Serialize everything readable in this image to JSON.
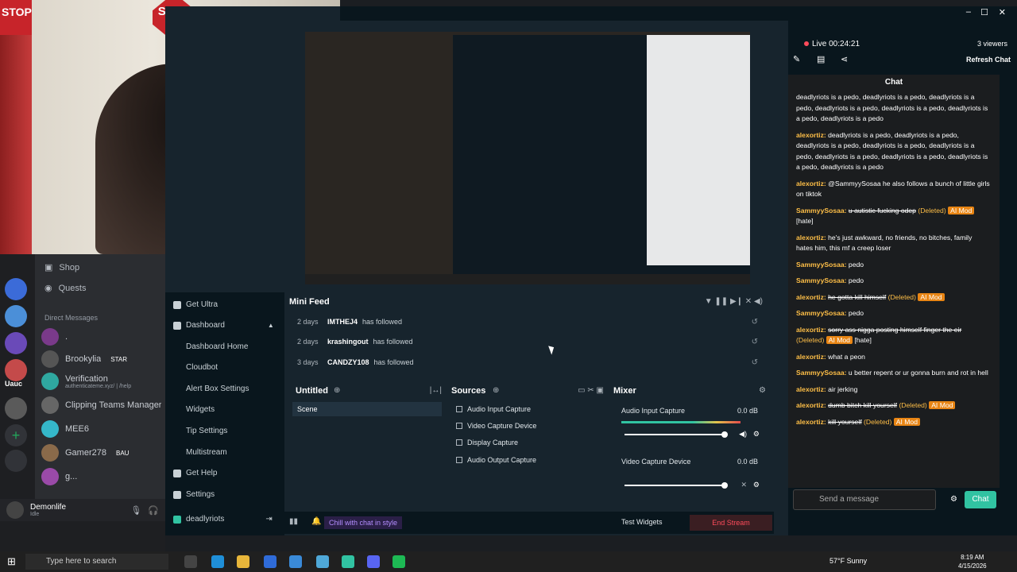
{
  "webcam": {
    "stop_left": "STOP",
    "stop_right": "STOP"
  },
  "discord": {
    "nav": [
      {
        "label": "Shop"
      },
      {
        "label": "Quests"
      }
    ],
    "dm_header": "Direct Messages",
    "dms": [
      {
        "name": ".",
        "tag": "",
        "sub": ""
      },
      {
        "name": "Brookylia",
        "tag": "STAR",
        "sub": ""
      },
      {
        "name": "Verification",
        "tag": "",
        "sub": "authenticateme.xyz/ | /help"
      },
      {
        "name": "Clipping Teams Manager",
        "tag": "",
        "sub": ""
      },
      {
        "name": "MEE6",
        "tag": "",
        "sub": ""
      },
      {
        "name": "Gamer278",
        "tag": "BAU",
        "sub": ""
      },
      {
        "name": "g...",
        "tag": "",
        "sub": ""
      }
    ],
    "guild_label": "Uauc",
    "user": {
      "name": "Demonlife",
      "status": "Idle"
    }
  },
  "streamlabs": {
    "nav": {
      "get_ultra": "Get Ultra",
      "dashboard": "Dashboard",
      "dashboard_home": "Dashboard Home",
      "cloudbot": "Cloudbot",
      "alert_box": "Alert Box Settings",
      "widgets": "Widgets",
      "tip_settings": "Tip Settings",
      "multistream": "Multistream",
      "get_help": "Get Help",
      "settings": "Settings",
      "account": "deadlyriots"
    },
    "mini_feed": {
      "title": "Mini Feed",
      "rows": [
        {
          "time": "2 days",
          "user": "IMTHEJ4",
          "action": "has followed"
        },
        {
          "time": "2 days",
          "user": "krashingout",
          "action": "has followed"
        },
        {
          "time": "3 days",
          "user": "CANDZY108",
          "action": "has followed"
        }
      ]
    },
    "scenes": {
      "title": "Untitled",
      "items": [
        "Scene"
      ]
    },
    "sources": {
      "title": "Sources",
      "items": [
        "Audio Input Capture",
        "Video Capture Device",
        "Display Capture",
        "Audio Output Capture"
      ]
    },
    "mixer": {
      "title": "Mixer",
      "channels": [
        {
          "name": "Audio Input Capture",
          "db": "0.0 dB"
        },
        {
          "name": "Video Capture Device",
          "db": "0.0 dB"
        }
      ]
    },
    "footer": {
      "chill": "Chill with chat in style",
      "test_widgets": "Test Widgets",
      "end_stream": "End Stream"
    }
  },
  "chat": {
    "live": "Live 00:24:21",
    "viewers": "3 viewers",
    "refresh": "Refresh Chat",
    "title": "Chat",
    "messages": [
      {
        "user": "",
        "text": "deadlyriots is a pedo, deadlyriots is a pedo, deadlyriots is a pedo, deadlyriots is a pedo, deadlyriots is a pedo, deadlyriots is a pedo, deadlyriots is a pedo",
        "deleted": false
      },
      {
        "user": "alexortiz:",
        "text": "deadlyriots is a pedo, deadlyriots is a pedo, deadlyriots is a pedo, deadlyriots is a pedo, deadlyriots is a pedo, deadlyriots is a pedo, deadlyriots is a pedo, deadlyriots is a pedo, deadlyriots is a pedo",
        "deleted": false
      },
      {
        "user": "alexortiz:",
        "text": "@SammyySosaa he also follows a bunch of little girls on tiktok",
        "deleted": false
      },
      {
        "user": "SammyySosaa:",
        "text": "u autistic fucking odep",
        "deleted": true,
        "extra": "[hate]"
      },
      {
        "user": "alexortiz:",
        "text": "he's just awkward, no friends, no bitches, family hates him, this mf a creep loser",
        "deleted": false
      },
      {
        "user": "SammyySosaa:",
        "text": "pedo",
        "deleted": false
      },
      {
        "user": "SammyySosaa:",
        "text": "pedo",
        "deleted": false
      },
      {
        "user": "alexortiz:",
        "text": "he gotta kill himself",
        "deleted": true,
        "extra": ""
      },
      {
        "user": "SammyySosaa:",
        "text": "pedo",
        "deleted": false
      },
      {
        "user": "alexortiz:",
        "text": "sorry ass nigga posting himself finger the eir",
        "deleted": true,
        "extra": "[hate]"
      },
      {
        "user": "alexortiz:",
        "text": "what a peon",
        "deleted": false
      },
      {
        "user": "SammyySosaa:",
        "text": "u better repent or ur gonna burn and rot in hell",
        "deleted": false
      },
      {
        "user": "alexortiz:",
        "text": "air jerking",
        "deleted": false
      },
      {
        "user": "alexortiz:",
        "text": "dumb bitch kill yourself",
        "deleted": true,
        "extra": ""
      },
      {
        "user": "alexortiz:",
        "text": "kill yourself",
        "deleted": true,
        "extra": ""
      }
    ],
    "deleted_label": "(Deleted)",
    "aimod_label": "AI Mod",
    "input_placeholder": "Send a message",
    "send_label": "Chat"
  },
  "taskbar": {
    "search_placeholder": "Type here to search",
    "weather": "57°F  Sunny",
    "time": "8:19 AM",
    "date": "4/15/2026"
  },
  "colors": {
    "accent": "#31c3a2",
    "live": "#ff4b5b",
    "username": "#ffbf47",
    "ai_mod": "#e88514"
  }
}
